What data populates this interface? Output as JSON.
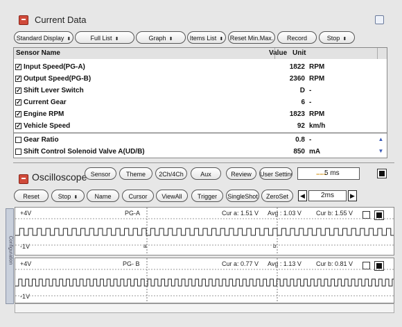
{
  "current_data": {
    "title": "Current Data",
    "toolbar": [
      {
        "label": "Standard Display",
        "dropdown": true
      },
      {
        "label": "Full List",
        "dropdown": true
      },
      {
        "label": "Graph",
        "dropdown": true
      },
      {
        "label": "Items List",
        "dropdown": true
      },
      {
        "label": "Reset Min.Max.",
        "dropdown": false
      },
      {
        "label": "Record",
        "dropdown": false
      },
      {
        "label": "Stop",
        "dropdown": true
      }
    ],
    "columns": {
      "name": "Sensor Name",
      "value": "Value",
      "unit": "Unit"
    },
    "rows": [
      {
        "name": "Input Speed(PG-A)",
        "value": "1822",
        "unit": "RPM",
        "checked": true
      },
      {
        "name": "Output Speed(PG-B)",
        "value": "2360",
        "unit": "RPM",
        "checked": true
      },
      {
        "name": "Shift Lever Switch",
        "value": "D",
        "unit": "-",
        "checked": true
      },
      {
        "name": "Current Gear",
        "value": "6",
        "unit": "-",
        "checked": true
      },
      {
        "name": "Engine RPM",
        "value": "1823",
        "unit": "RPM",
        "checked": true
      },
      {
        "name": "Vehicle Speed",
        "value": "92",
        "unit": "km/h",
        "checked": true
      },
      {
        "name": "Gear Ratio",
        "value": "0.8",
        "unit": "-",
        "checked": false
      },
      {
        "name": "Shift Control Solenoid Valve A(UD/B)",
        "value": "850",
        "unit": "mA",
        "checked": false
      }
    ]
  },
  "oscilloscope": {
    "title": "Oscilloscope",
    "top_buttons": [
      "Sensor",
      "Theme",
      "2Ch/4Ch",
      "Aux",
      "Review",
      "User Setting"
    ],
    "timebase_display": "5 ms",
    "controls": [
      {
        "label": "Reset",
        "dropdown": false
      },
      {
        "label": "Stop",
        "dropdown": true
      },
      {
        "label": "Name",
        "dropdown": false
      },
      {
        "label": "Cursor",
        "dropdown": false
      },
      {
        "label": "ViewAll",
        "dropdown": false
      },
      {
        "label": "Trigger",
        "dropdown": false
      },
      {
        "label": "SingleShot",
        "dropdown": false
      },
      {
        "label": "ZeroSet",
        "dropdown": false
      }
    ],
    "timebase_value": "2ms",
    "side_tab": "Configuration",
    "channels": [
      {
        "scale_top": "+4V",
        "scale_bottom": "-1V",
        "name": "PG-A",
        "cur_a": "Cur a: 1.51 V",
        "avg": "Avg : 1.03 V",
        "cur_b": "Cur b: 1.55 V",
        "cursor_a": "a",
        "cursor_b": "b"
      },
      {
        "scale_top": "+4V",
        "scale_bottom": "-1V",
        "name": "PG- B",
        "cur_a": "Cur a: 0.77 V",
        "avg": "Avg : 1.13 V",
        "cur_b": "Cur b: 0.81 V"
      }
    ]
  }
}
